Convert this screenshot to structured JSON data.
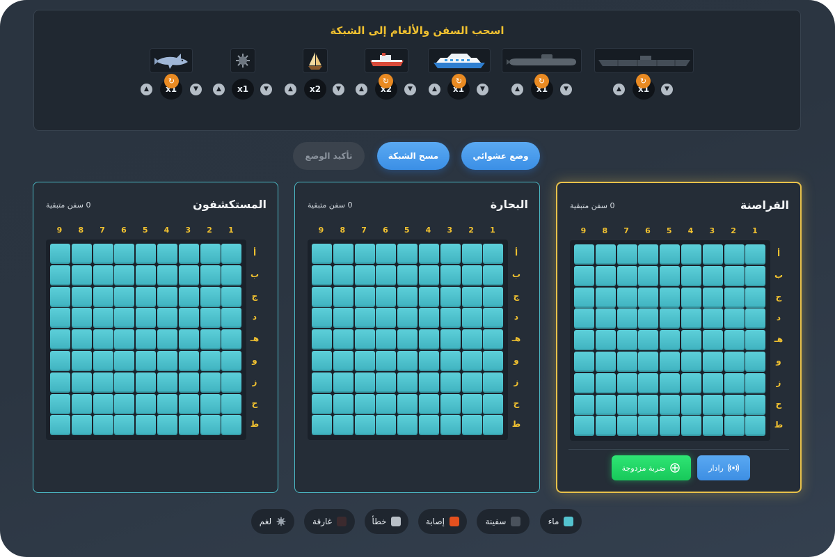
{
  "palette": {
    "title": "اسحب السفن والألغام إلى الشبكة",
    "pieces": [
      {
        "name": "shark",
        "count": "x1",
        "icon": "shark-icon",
        "rotatable": true
      },
      {
        "name": "mine",
        "count": "x1",
        "icon": "mine-icon",
        "rotatable": false
      },
      {
        "name": "sailboat",
        "count": "x2",
        "icon": "sailboat-icon",
        "rotatable": false
      },
      {
        "name": "small-ship",
        "count": "x2",
        "icon": "ship-icon",
        "rotatable": true
      },
      {
        "name": "cruise-ship",
        "count": "x1",
        "icon": "cruise-ship-icon",
        "rotatable": true
      },
      {
        "name": "submarine",
        "count": "x1",
        "icon": "submarine-icon",
        "rotatable": true
      },
      {
        "name": "battleship",
        "count": "x1",
        "icon": "battleship-icon",
        "rotatable": true
      }
    ],
    "up_glyph": "▲",
    "down_glyph": "▼",
    "rotate_glyph": "↻"
  },
  "actions": {
    "random": "وضع عشوائي",
    "clear": "مسح الشبكة",
    "confirm": "تأكيد الوضع"
  },
  "boards": [
    {
      "name": "القراصنة",
      "remaining": "0 سفن متبقية",
      "active": true
    },
    {
      "name": "البحارة",
      "remaining": "0 سفن متبقية",
      "active": false
    },
    {
      "name": "المستكشفون",
      "remaining": "0 سفن متبقية",
      "active": false
    }
  ],
  "columns": [
    "1",
    "2",
    "3",
    "4",
    "5",
    "6",
    "7",
    "8",
    "9"
  ],
  "rows": [
    "أ",
    "ب",
    "ج",
    "د",
    "هـ",
    "و",
    "ز",
    "ح",
    "ط"
  ],
  "tools": {
    "radar": "رادار",
    "radar_icon": "radar-icon",
    "strike": "ضربة مزدوجة",
    "strike_icon": "crosshair-icon"
  },
  "legend": [
    {
      "label": "ماء",
      "color": "#54c3cf"
    },
    {
      "label": "سفينة",
      "color": "#4a525c"
    },
    {
      "label": "إصابة",
      "color": "#e4501e"
    },
    {
      "label": "خطأ",
      "color": "#b9c0c7"
    },
    {
      "label": "غارقة",
      "color": "#3b2a2e"
    },
    {
      "label": "لغم",
      "color": "#9aa3ad",
      "icon": "mine-icon"
    }
  ],
  "colors": {
    "accent": "#f2c230",
    "water": "#4ec0cc",
    "blue": "#4a9ceb",
    "green": "#22d866"
  }
}
